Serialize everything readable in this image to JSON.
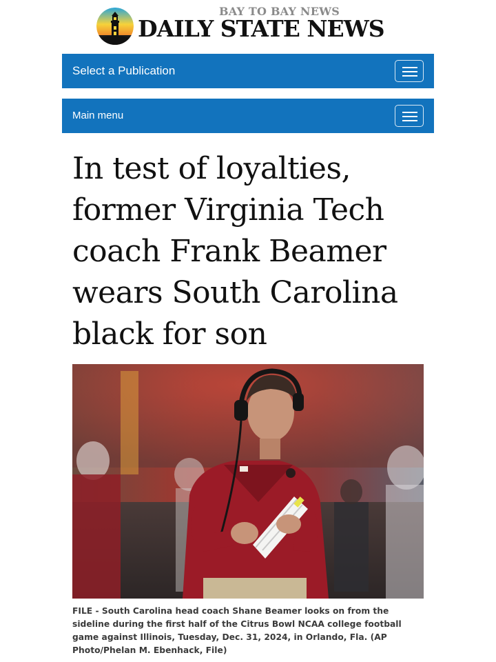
{
  "masthead": {
    "tagline": "BAY TO BAY NEWS",
    "brand": "DAILY STATE NEWS",
    "logo_icon": "lighthouse-sunset-icon"
  },
  "nav": {
    "publication_label": "Select a Publication",
    "main_menu_label": "Main menu",
    "toggle_icon": "hamburger-menu-icon",
    "bar_color": "#1273bd"
  },
  "article": {
    "headline": "In test of loyalties, former Virginia Tech coach Frank Beamer wears South Carolina black for son",
    "photo_caption": "FILE - South Carolina head coach Shane Beamer looks on from the sideline during the first half of the Citrus Bowl NCAA college football game against Illinois, Tuesday, Dec. 31, 2024, in Orlando, Fla. (AP Photo/Phelan M. Ebenhack, File)"
  }
}
